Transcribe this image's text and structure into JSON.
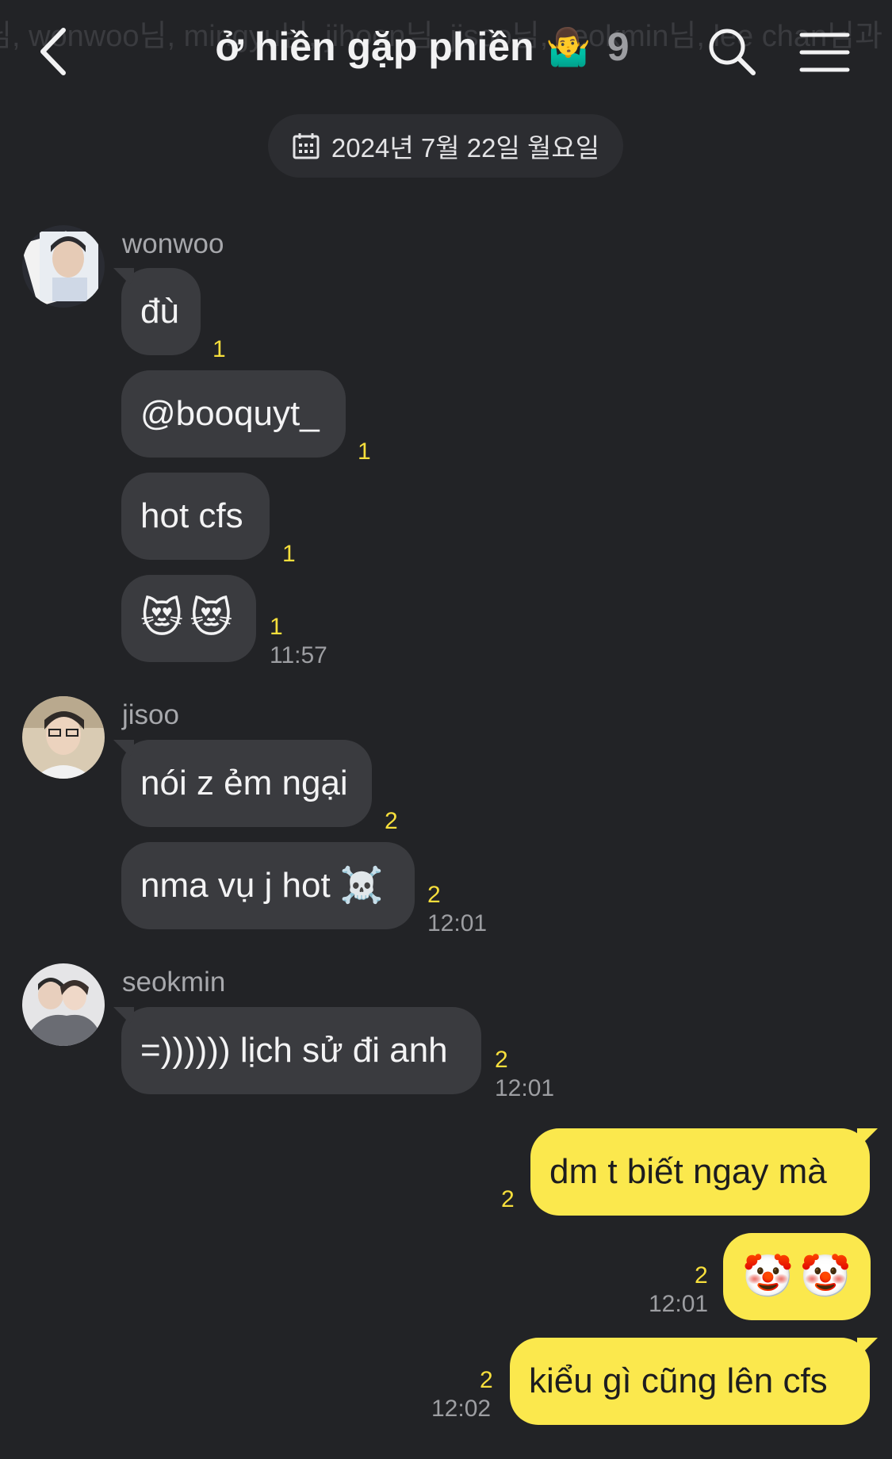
{
  "header": {
    "participants_text": "님, wonwoo님, mingyu님, jihoon님, jisoo님, seokmin님, lee chan님과 나",
    "title": "ở hiền gặp phiền",
    "title_emoji": "🤷‍♂️",
    "member_count": "9"
  },
  "date_divider": "2024년 7월 22일 월요일",
  "messages": [
    {
      "sender": "wonwoo",
      "text": "đù",
      "unread": "1"
    },
    {
      "text": "@booquyt_",
      "unread": "1"
    },
    {
      "text": "hot cfs",
      "unread": "1"
    },
    {
      "text": "😻😻",
      "unread": "1",
      "time": "11:57"
    },
    {
      "sender": "jisoo",
      "text": "nói z ẻm ngại",
      "unread": "2"
    },
    {
      "text": "nma vụ j hot ☠️",
      "unread": "2",
      "time": "12:01"
    },
    {
      "sender": "seokmin",
      "text": "=)))))) lịch sử đi anh",
      "unread": "2",
      "time": "12:01"
    },
    {
      "text": "dm t biết ngay mà",
      "unread": "2"
    },
    {
      "text": "🤡🤡",
      "unread": "2",
      "time": "12:01"
    },
    {
      "text": "kiểu gì cũng lên cfs",
      "unread": "2",
      "time": "12:02"
    }
  ],
  "colors": {
    "background": "#222326",
    "incoming_bubble": "#3a3b3f",
    "outgoing_bubble": "#fbe84d",
    "unread": "#f7df3c"
  }
}
